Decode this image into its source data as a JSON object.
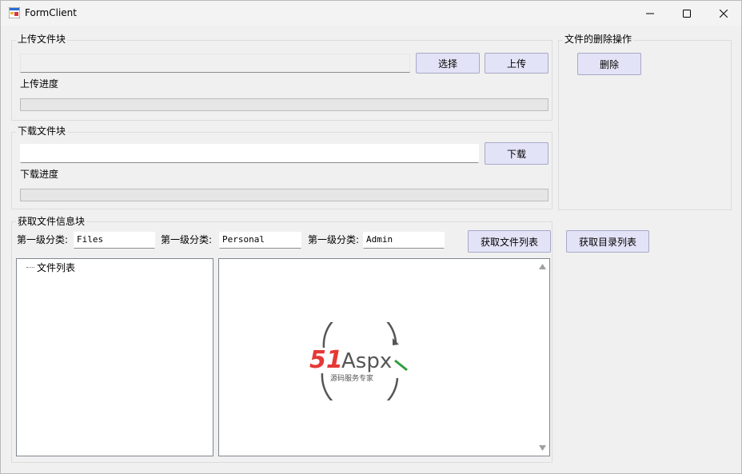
{
  "window": {
    "title": "FormClient"
  },
  "upload": {
    "group_title": "上传文件块",
    "file_path": "",
    "select_label": "选择",
    "upload_label": "上传",
    "progress_label": "上传进度",
    "progress": 0
  },
  "delete": {
    "group_title": "文件的删除操作",
    "delete_label": "删除"
  },
  "download": {
    "group_title": "下载文件块",
    "file_path": "",
    "download_label": "下载",
    "progress_label": "下载进度",
    "progress": 0
  },
  "info": {
    "group_title": "获取文件信息块",
    "category1_label": "第一级分类:",
    "category1_value": "Files",
    "category2_label": "第一级分类:",
    "category2_value": "Personal",
    "category3_label": "第一级分类:",
    "category3_value": "Admin",
    "get_file_list_label": "获取文件列表",
    "get_dir_list_label": "获取目录列表",
    "tree_root": "文件列表"
  },
  "watermark": {
    "brand_red": "51",
    "brand_dark": "Aspx",
    "tagline": "源码服务专家",
    "colors": {
      "red": "#e53935",
      "dark": "#555555",
      "green": "#2e9e3e"
    }
  }
}
